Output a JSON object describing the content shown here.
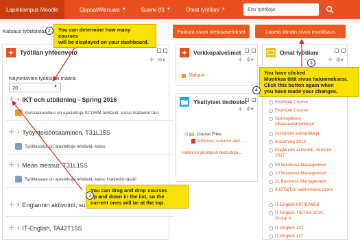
{
  "navbar": {
    "brand": "Lapinkampus Moodle",
    "items": [
      {
        "label": "Oppaat/Manuals"
      },
      {
        "label": "Suomi (fi)"
      },
      {
        "label": "Omat työtilani"
      }
    ],
    "search_placeholder": "Etsi työtiloja"
  },
  "header": {
    "text": "Katsaus työtiloistasi",
    "reset_button": "Palauta sivun oletusasetukset",
    "stop_edit_button": "Lopeta tämän sivun muokkaus"
  },
  "overview": {
    "title": "Työtilan yhteenveto",
    "count_label": "Näytettävien työtilojen määrä:",
    "count_value": "20",
    "courses": [
      {
        "title": "IKT och utbildning - Spring 2016",
        "task": "Kurssialueellasi on ajastettuja SCORM-tehtäviä; katso lisätiedot täst"
      },
      {
        "title": "Työyhteisöosaaminen, T31L15S",
        "task": "Työtilassasi on ajastettuja tehtäviä; katso"
      },
      {
        "title": "Meän messut, T31L15S",
        "task": "Työtilassasi on ajastettuja tehtäviä; katso lisätiedot tästä!"
      },
      {
        "title": "Englannin aktivointi, summer 2017",
        "task": ""
      },
      {
        "title": "IT-English, TA42T15S",
        "task": ""
      }
    ]
  },
  "web_services": {
    "title": "Verkkopalvelimet",
    "item": "Mahara"
  },
  "private_files": {
    "title": "Yksityiset tiedostot",
    "items": [
      "Course Files",
      "Atheism, science and ..."
    ],
    "manage_link": "Hallinnoi yksityisiä tiedostoja..."
  },
  "my_courses": {
    "title": "Omat työtilani",
    "items": [
      "Example Course",
      "Example Course",
      "Opintojakson ulkoasuesimerkkejä",
      "Arviointiin esimerkkejä",
      "eLearning 2012",
      "Englannin aktivointi, summer 2017",
      "09 Business Management",
      "10 Business Management",
      "11 Business Management",
      "A10TieTra, valmentava ruotsi",
      "IT-English 09T/E/WEB",
      "IT-English TIETRA 2010, Group A",
      "IT-English 10T",
      "IT-English 11T"
    ]
  },
  "callouts": {
    "c1": "You have clicked\nMuokkaa tätä sivua haluamaksesi.\nClick this button again when\nyou have made your changes.",
    "c2": "You can determine how many courses\nwill be displayed on your dashboard.",
    "c3": "You can drag and drop courses\nup and down in the list, so the\ncurrent ones will be at the top.",
    "n1": "1",
    "n2": "2",
    "n3": "3",
    "n4": "4"
  }
}
